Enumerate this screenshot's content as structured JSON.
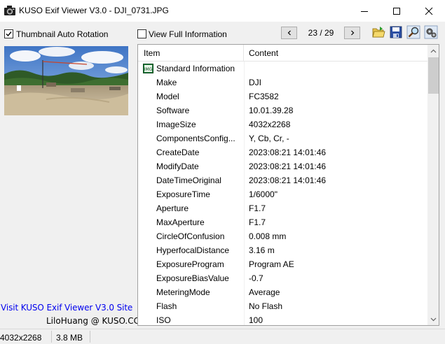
{
  "window": {
    "title": "KUSO Exif Viewer V3.0 - DJI_0731.JPG"
  },
  "toolbar": {
    "thumbnail_auto_rotation": {
      "label": "Thumbnail Auto Rotation",
      "checked": true
    },
    "view_full_information": {
      "label": "View Full Information",
      "checked": false
    },
    "counter": "23 / 29",
    "icons": [
      "open-folder-icon",
      "save-icon",
      "search-icon",
      "settings-icon"
    ]
  },
  "left": {
    "site_link": "Visit KUSO Exif Viewer V3.0 Site",
    "credit": "LiloHuang @ KUSO.CC"
  },
  "table": {
    "columns": [
      "Item",
      "Content"
    ],
    "group": "Standard Information",
    "rows": [
      {
        "item": "Make",
        "content": "DJI"
      },
      {
        "item": "Model",
        "content": "FC3582"
      },
      {
        "item": "Software",
        "content": "10.01.39.28"
      },
      {
        "item": "ImageSize",
        "content": "4032x2268"
      },
      {
        "item": "ComponentsConfig...",
        "content": "Y, Cb, Cr, -"
      },
      {
        "item": "CreateDate",
        "content": "2023:08:21 14:01:46"
      },
      {
        "item": "ModifyDate",
        "content": "2023:08:21 14:01:46"
      },
      {
        "item": "DateTimeOriginal",
        "content": "2023:08:21 14:01:46"
      },
      {
        "item": "ExposureTime",
        "content": "1/6000\""
      },
      {
        "item": "Aperture",
        "content": "F1.7"
      },
      {
        "item": "MaxAperture",
        "content": "F1.7"
      },
      {
        "item": "CircleOfConfusion",
        "content": "0.008 mm"
      },
      {
        "item": "HyperfocalDistance",
        "content": "3.16 m"
      },
      {
        "item": "ExposureProgram",
        "content": "Program AE"
      },
      {
        "item": "ExposureBiasValue",
        "content": "-0.7"
      },
      {
        "item": "MeteringMode",
        "content": "Average"
      },
      {
        "item": "Flash",
        "content": "No Flash"
      },
      {
        "item": "ISO",
        "content": "100"
      }
    ]
  },
  "status": {
    "dimensions": "4032x2268",
    "file_size": "3.8 MB"
  }
}
